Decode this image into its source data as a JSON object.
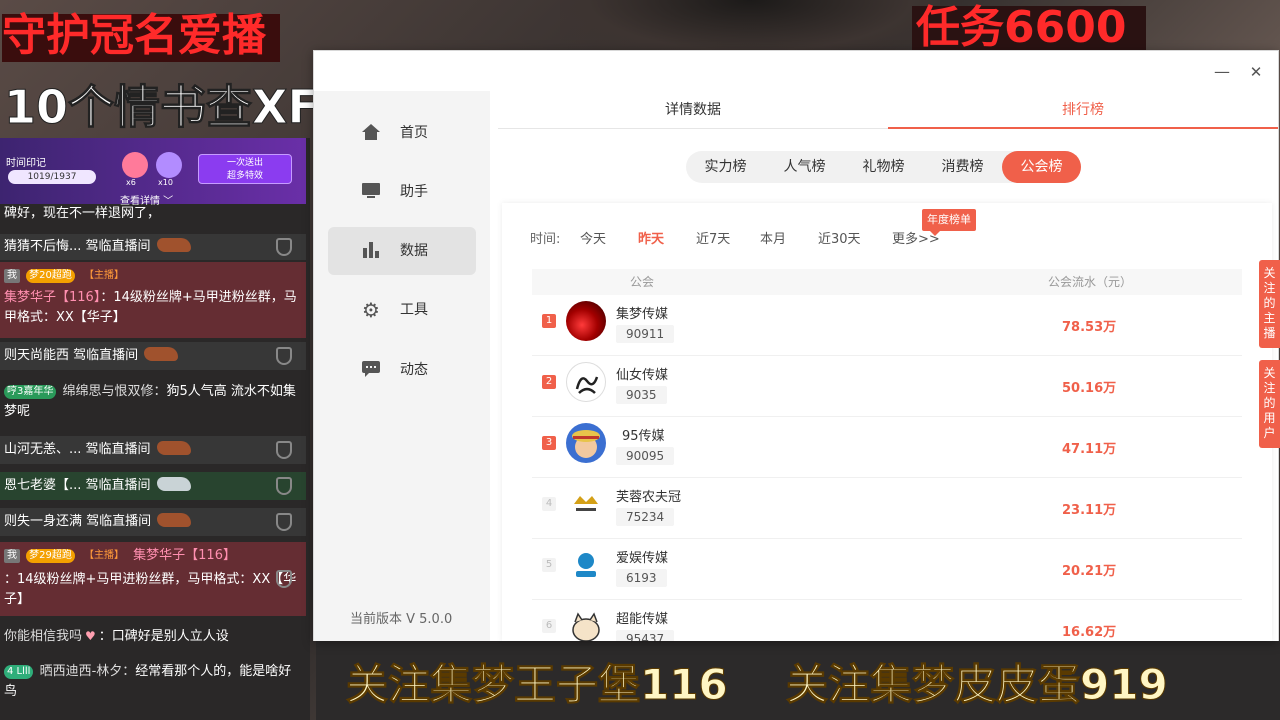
{
  "overlay": {
    "top_left_red": "守护冠名爱播",
    "top_left_white": "10个情书查XF",
    "top_right_red": "任务6600",
    "bottom_left": "关注集梦王子堡116",
    "bottom_right": "关注集梦皮皮蛋919"
  },
  "chat": {
    "banner": {
      "title": "时间印记",
      "progress": "1019/1937",
      "gift_count_1": "x6",
      "gift_count_2": "x10",
      "button_line1": "一次送出",
      "button_line2": "超多特效",
      "more": "查看详情 ﹀"
    },
    "lines": {
      "l1": "碑好，现在不一样退网了，",
      "l2_user": "猜猜不后悔...",
      "l2_text": "驾临直播间",
      "l3_me": "我",
      "l3_level": "梦20超跑",
      "l3_anchor": "【主播】",
      "l3_user": "集梦华子【116】",
      "l3_sep": "：",
      "l3_text": "14级粉丝牌+马甲进粉丝群，马甲格式：XX【华子】",
      "l4_user": "则天尚能西",
      "l4_text": "驾临直播间",
      "l5_level": "哼3嘉年华",
      "l5_user": "绵绵思与恨双修：",
      "l5_text": "狗5人气高 流水不如集梦呢",
      "l6_user": "山河无恙、...",
      "l6_text": "驾临直播间",
      "l7_user": "恩七老婆【...",
      "l7_text": "驾临直播间",
      "l8_user": "则失一身还满",
      "l8_text": "驾临直播间",
      "l9_me": "我",
      "l9_level": "梦29超跑",
      "l9_anchor": "【主播】",
      "l9_user": "集梦华子【116】",
      "l9_text": "：14级粉丝牌+马甲进粉丝群，马甲格式：XX【华子】",
      "l10_user": "你能相信我吗",
      "l10_text": "：口碑好是别人立人设",
      "l11_level": "4 Llll",
      "l11_user": "晒西迪西-林夕：",
      "l11_text": "经常看那个人的，能是啥好鸟"
    }
  },
  "window": {
    "controls": {
      "minimize": "—",
      "close": "✕"
    },
    "sidebar": {
      "items": [
        {
          "label": "首页",
          "icon": "home-icon"
        },
        {
          "label": "助手",
          "icon": "monitor-icon"
        },
        {
          "label": "数据",
          "icon": "bar-chart-icon"
        },
        {
          "label": "工具",
          "icon": "gear-icon"
        },
        {
          "label": "动态",
          "icon": "message-icon"
        }
      ],
      "active_index": 2,
      "version": "当前版本 V 5.0.0"
    },
    "top_tabs": [
      "详情数据",
      "排行榜"
    ],
    "segments": [
      "实力榜",
      "人气榜",
      "礼物榜",
      "消费榜",
      "公会榜"
    ],
    "time": {
      "label": "时间:",
      "options": [
        "今天",
        "昨天",
        "近7天",
        "本月",
        "近30天",
        "更多>>"
      ],
      "active": "昨天",
      "year_tag": "年度榜单"
    },
    "table": {
      "head_guild": "公会",
      "head_flow": "公会流水（元）",
      "rows": [
        {
          "rank": "1",
          "name": "集梦传媒",
          "id": "90911",
          "flow": "78.53万"
        },
        {
          "rank": "2",
          "name": "仙女传媒",
          "id": "9035",
          "flow": "50.16万"
        },
        {
          "rank": "3",
          "name": "95传媒",
          "id": "90095",
          "flow": "47.11万"
        },
        {
          "rank": "4",
          "name": "芙蓉农夫冠",
          "id": "75234",
          "flow": "23.11万"
        },
        {
          "rank": "5",
          "name": "爱娱传媒",
          "id": "6193",
          "flow": "20.21万"
        },
        {
          "rank": "6",
          "name": "超能传媒",
          "id": "95437",
          "flow": "16.62万"
        }
      ]
    },
    "side_tabs": [
      "关注的主播",
      "关注的用户"
    ]
  }
}
